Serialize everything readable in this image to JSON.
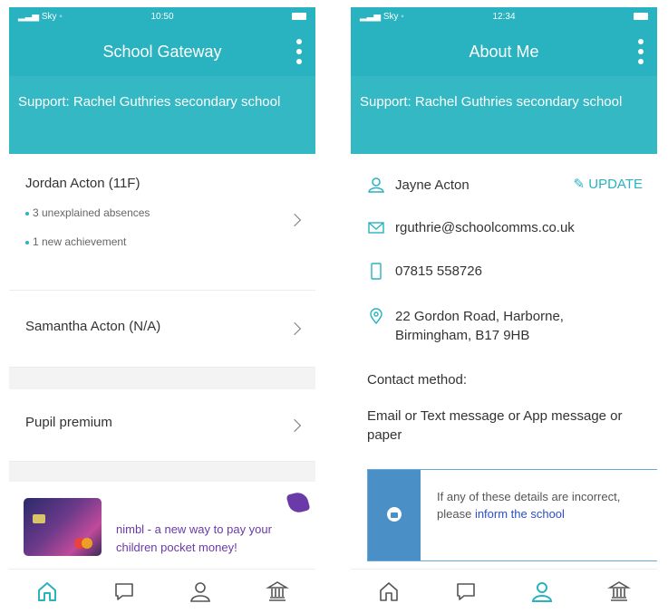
{
  "phone1": {
    "status": {
      "carrier": "Sky",
      "time": "10:50"
    },
    "title": "School Gateway",
    "support": "Support: Rachel Guthries secondary school",
    "students": [
      {
        "name": "Jordan Acton (11F)",
        "bullets": [
          "3 unexplained absences",
          "1 new achievement"
        ]
      },
      {
        "name": "Samantha Acton (N/A)"
      }
    ],
    "pupil_premium": "Pupil premium",
    "promo": {
      "text": "nimbl - a new way to pay your children pocket money!"
    },
    "tabs": [
      "home-icon",
      "chat-icon",
      "user-icon",
      "bank-icon"
    ]
  },
  "phone2": {
    "status": {
      "carrier": "Sky",
      "time": "12:34"
    },
    "title": "About Me",
    "support": "Support: Rachel Guthries secondary school",
    "name": "Jayne Acton",
    "update_label": "UPDATE",
    "email": "rguthrie@schoolcomms.co.uk",
    "phone": "07815 558726",
    "address": "22 Gordon Road, Harborne, Birmingham, B17 9HB",
    "contact_label": "Contact method:",
    "contact_value": "Email or Text message or App message or paper",
    "notice_text": "If any of these details are incorrect, please",
    "notice_link": "inform the school",
    "tabs": [
      "home-icon",
      "chat-icon",
      "user-icon",
      "bank-icon"
    ]
  },
  "colors": {
    "accent": "#29b2bf",
    "notice_bar": "#4a8fc5",
    "link": "#2b4fc8",
    "promo": "#6a3aa8"
  }
}
